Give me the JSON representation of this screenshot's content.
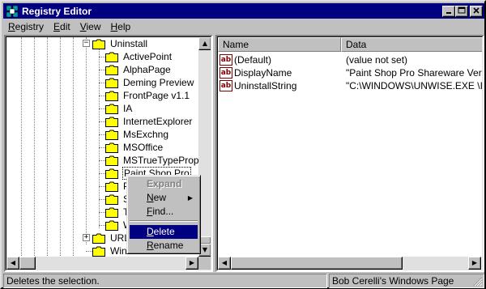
{
  "window": {
    "title": "Registry Editor",
    "controls": {
      "minimize": "_",
      "maximize": "□",
      "close": "×"
    }
  },
  "menubar": {
    "items": [
      {
        "label": "Registry",
        "accel": "R",
        "rest": "egistry"
      },
      {
        "label": "Edit",
        "accel": "E",
        "rest": "dit"
      },
      {
        "label": "View",
        "accel": "V",
        "rest": "iew"
      },
      {
        "label": "Help",
        "accel": "H",
        "rest": "elp"
      }
    ]
  },
  "tree": {
    "parent": "Uninstall",
    "children": [
      "ActivePoint",
      "AlphaPage",
      "Deming Preview",
      "FrontPage v1.1",
      "IA",
      "InternetExplorer",
      "MsExchng",
      "MSOffice",
      "MSTrueTypePropert",
      "Paint Shop Pro",
      "P",
      "S",
      "T",
      "W"
    ],
    "selected": "Paint Shop Pro",
    "bottom_items": [
      "URL",
      "Wind"
    ]
  },
  "list": {
    "columns": [
      "Name",
      "Data"
    ],
    "rows": [
      {
        "icon": "ab",
        "name": "(Default)",
        "data": "(value not set)"
      },
      {
        "icon": "ab",
        "name": "DisplayName",
        "data": "\"Paint Shop Pro Shareware Version"
      },
      {
        "icon": "ab",
        "name": "UninstallString",
        "data": "\"C:\\WINDOWS\\UNWISE.EXE \\INS"
      }
    ]
  },
  "context_menu": {
    "items": [
      {
        "label": "Expand",
        "disabled": true
      },
      {
        "label": "New",
        "accel": "N",
        "rest": "ew",
        "submenu": true
      },
      {
        "label": "Find...",
        "accel": "F",
        "rest": "ind..."
      },
      {
        "label": "Delete",
        "accel": "D",
        "rest": "elete",
        "highlighted": true
      },
      {
        "label": "Rename",
        "accel": "R",
        "rest": "ename"
      }
    ],
    "submenu_arrow": "▶"
  },
  "statusbar": {
    "message": "Deletes the selection.",
    "right_text": "Bob Cerelli's Windows Page"
  },
  "colors": {
    "title_bg": "#000080",
    "face": "#c0c0c0",
    "folder": "#ffff00",
    "highlight": "#000080"
  }
}
